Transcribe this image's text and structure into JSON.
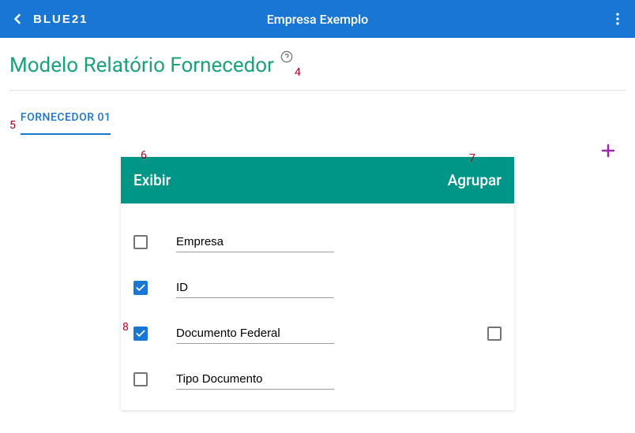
{
  "header": {
    "logo": "BLUE21",
    "title": "Empresa Exemplo"
  },
  "page": {
    "title": "Modelo Relatório Fornecedor"
  },
  "annotations": {
    "a4": "4",
    "a5": "5",
    "a6": "6",
    "a7": "7",
    "a8": "8"
  },
  "tabs": {
    "active": "FORNECEDOR 01"
  },
  "card": {
    "header_left": "Exibir",
    "header_right": "Agrupar",
    "fields": [
      {
        "label": "Empresa",
        "exibir": false,
        "agrupar": null
      },
      {
        "label": "ID",
        "exibir": true,
        "agrupar": null
      },
      {
        "label": "Documento Federal",
        "exibir": true,
        "agrupar": false
      },
      {
        "label": "Tipo Documento",
        "exibir": false,
        "agrupar": null
      }
    ]
  }
}
